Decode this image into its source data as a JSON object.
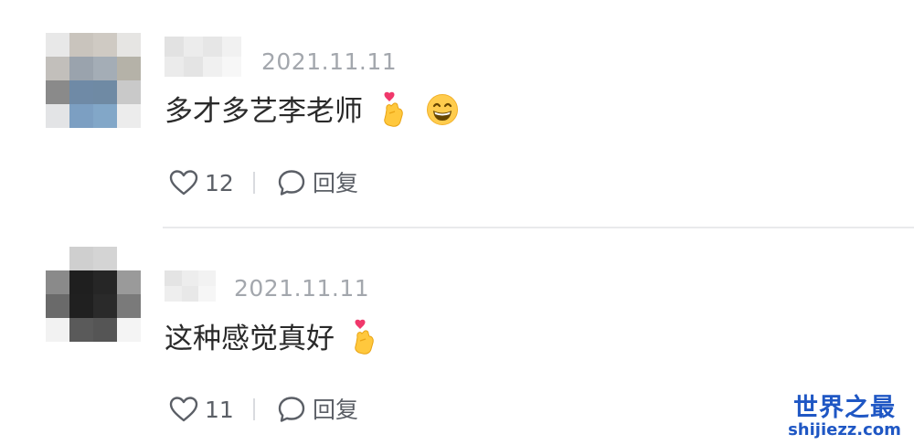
{
  "comments": [
    {
      "timestamp": "2021.11.11",
      "text": "多才多艺李老师",
      "emojis": [
        "finger-heart-emoji",
        "grinning-face-emoji"
      ],
      "like_count": "12",
      "reply_label": "回复"
    },
    {
      "timestamp": "2021.11.11",
      "text": "这种感觉真好",
      "emojis": [
        "finger-heart-emoji"
      ],
      "like_count": "11",
      "reply_label": "回复"
    }
  ],
  "icons": {
    "like": "heart-outline-icon",
    "reply": "speech-bubble-icon"
  },
  "watermark": {
    "title": "世界之最",
    "url": "shijiezz.com"
  },
  "colors": {
    "text_primary": "#2a2a2a",
    "text_secondary": "#a3a7ad",
    "action_text": "#5b5f66",
    "watermark": "#1f57c4",
    "divider": "#e9eaec"
  }
}
